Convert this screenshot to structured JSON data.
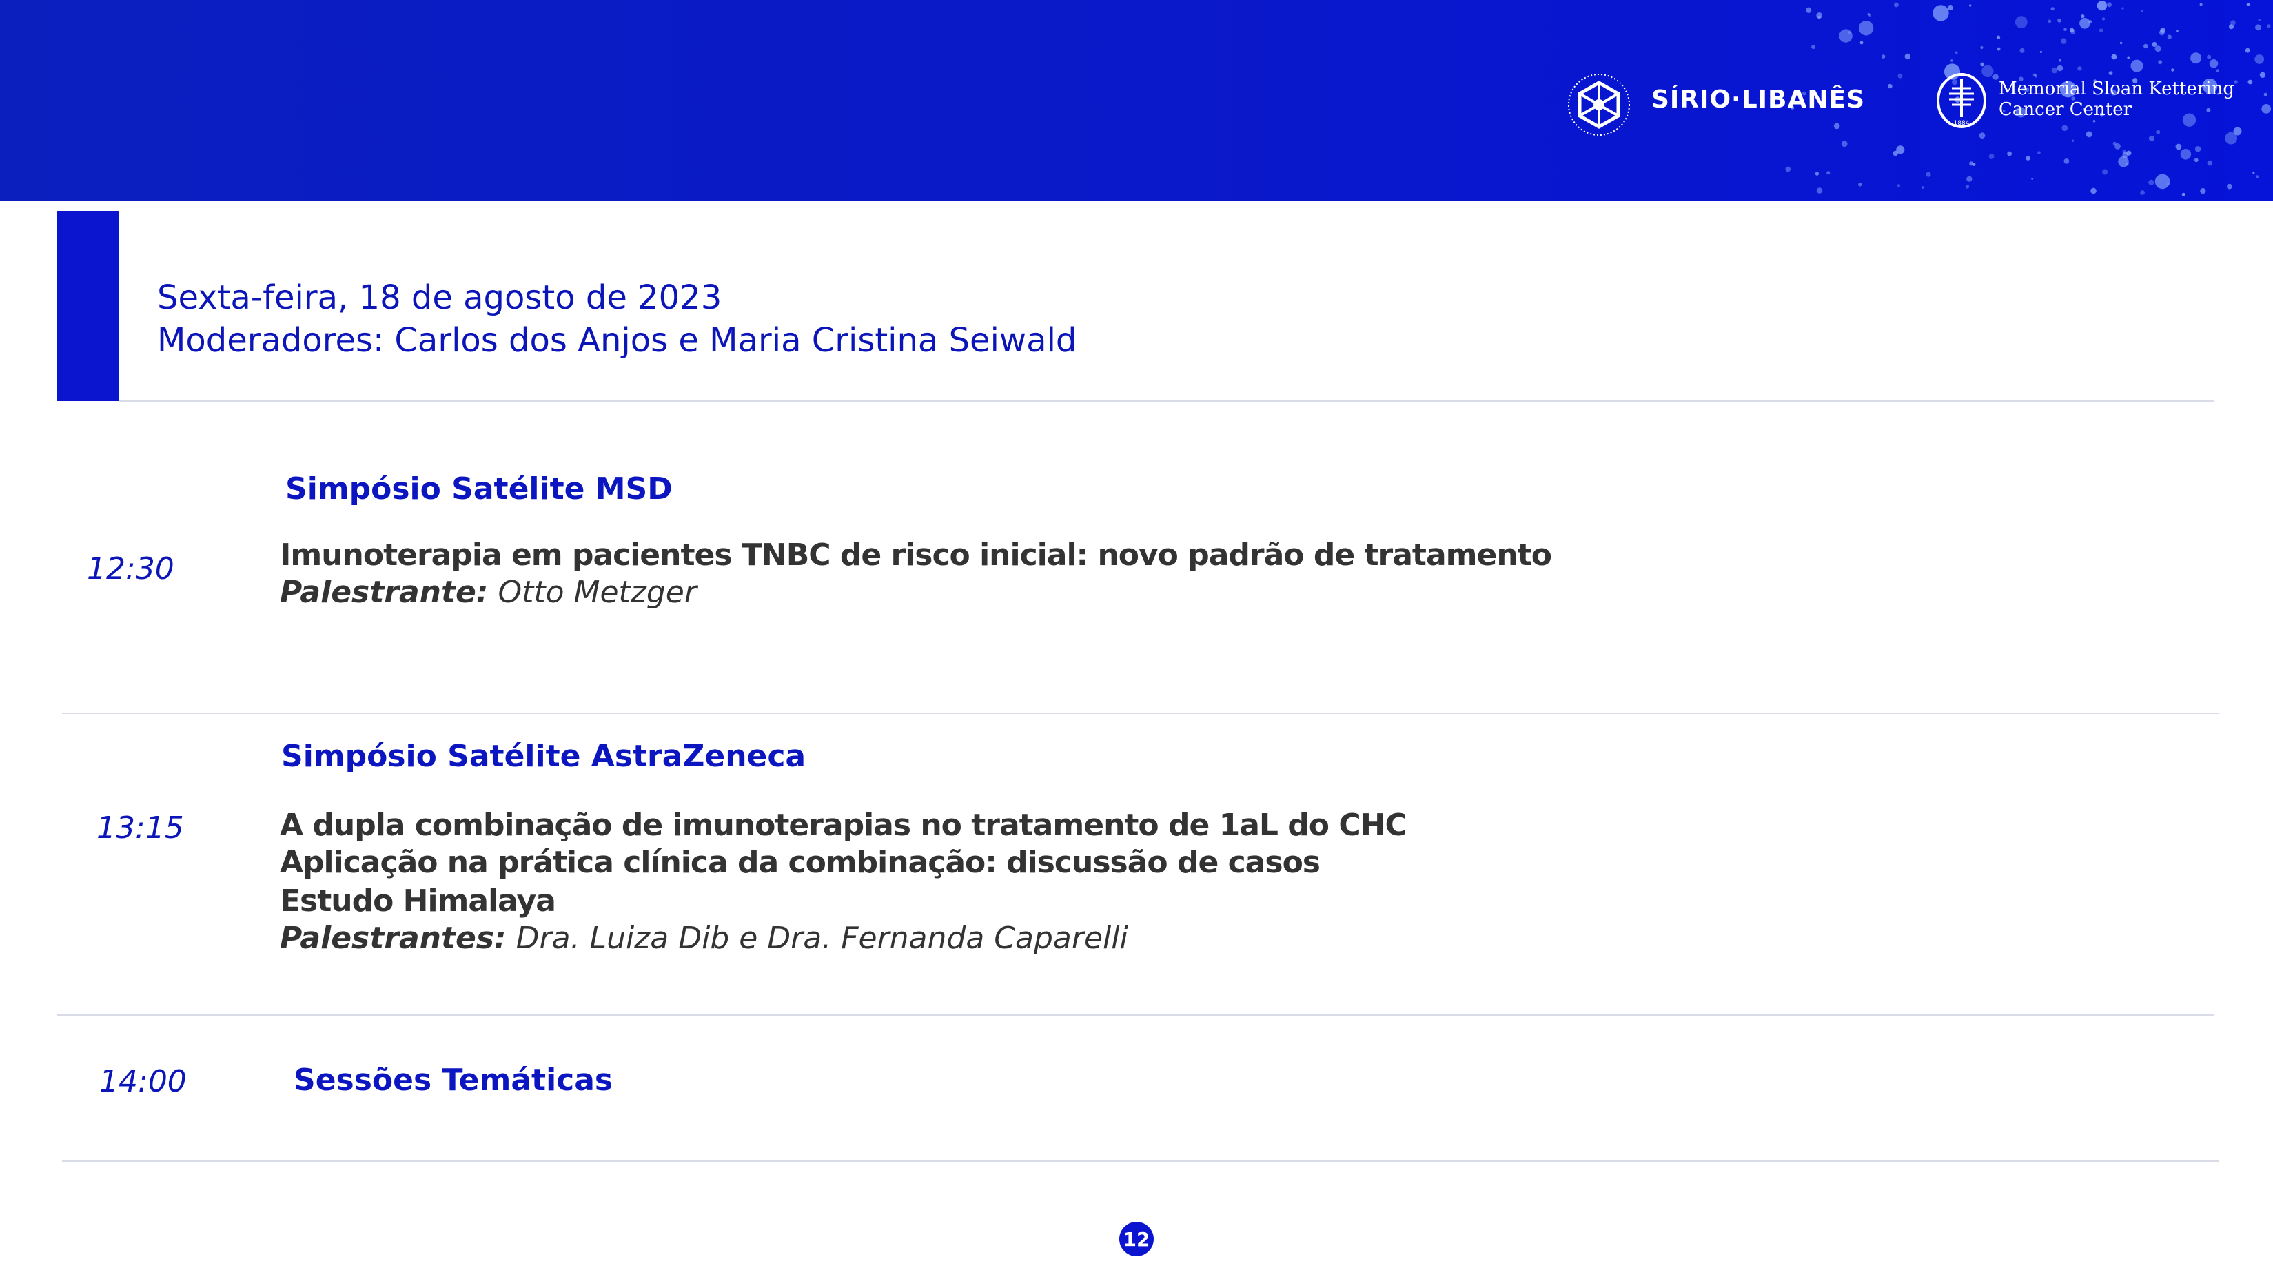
{
  "header": {
    "logo_primary_text": "SÍRIO·LIBANÊS",
    "logo_secondary_line1": "Memorial Sloan Kettering",
    "logo_secondary_line2": "Cancer Center",
    "logo_secondary_year": "1884"
  },
  "date_block": {
    "date": "Sexta-feira, 18 de agosto de 2023",
    "moderators": "Moderadores: Carlos dos Anjos e Maria Cristina Seiwald"
  },
  "sessions": [
    {
      "title": "Simpósio Satélite MSD",
      "time": "12:30",
      "talks": [
        "Imunoterapia em pacientes TNBC de risco inicial: novo padrão de tratamento"
      ],
      "speaker_label": "Palestrante:",
      "speaker_names": " Otto Metzger"
    },
    {
      "title": "Simpósio Satélite AstraZeneca",
      "time": "13:15",
      "talks": [
        "A dupla combinação de imunoterapias no tratamento de 1aL do CHC",
        "Aplicação na prática clínica da combinação: discussão de casos",
        "Estudo Himalaya"
      ],
      "speaker_label": "Palestrantes:",
      "speaker_names": " Dra. Luiza Dib e Dra. Fernanda Caparelli"
    },
    {
      "title": "Sessões Temáticas",
      "time": "14:00"
    }
  ],
  "page_number": "12",
  "colors": {
    "brand_blue": "#0b14cf",
    "heading_blue": "#0c16c0",
    "body_text": "#333333"
  }
}
